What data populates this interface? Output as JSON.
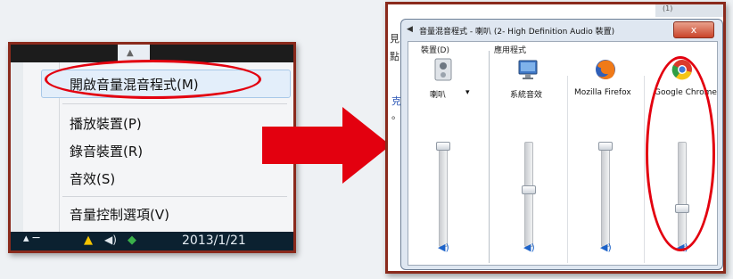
{
  "left": {
    "menu_items": [
      "開啟音量混音程式(M)",
      "播放裝置(P)",
      "錄音裝置(R)",
      "音效(S)",
      "音量控制選項(V)"
    ],
    "taskbar": {
      "clock": "2013/1/21"
    }
  },
  "right": {
    "background_text": [
      "見，",
      "點",
      "克",
      "。"
    ],
    "background_strip": "(1)",
    "mixer": {
      "title": "音量混音程式 - 喇叭 (2- High Definition Audio 裝置)",
      "close_label": "x",
      "device_group_label": "裝置(D)",
      "apps_group_label": "應用程式",
      "device": {
        "name": "喇叭",
        "dropdown": "▾",
        "level": 1.0
      },
      "apps": [
        {
          "name": "系統音效",
          "level": 0.55
        },
        {
          "name": "Mozilla Firefox",
          "level": 1.0
        },
        {
          "name": "Google Chrome",
          "level": 0.35
        }
      ]
    }
  },
  "colors": {
    "annotation_red": "#e3000f",
    "frame": "#8a2a1c"
  },
  "icons": [
    "speaker-icon",
    "system-sounds-icon",
    "firefox-icon",
    "chrome-icon",
    "volume-icon",
    "warning-icon",
    "shield-icon"
  ]
}
